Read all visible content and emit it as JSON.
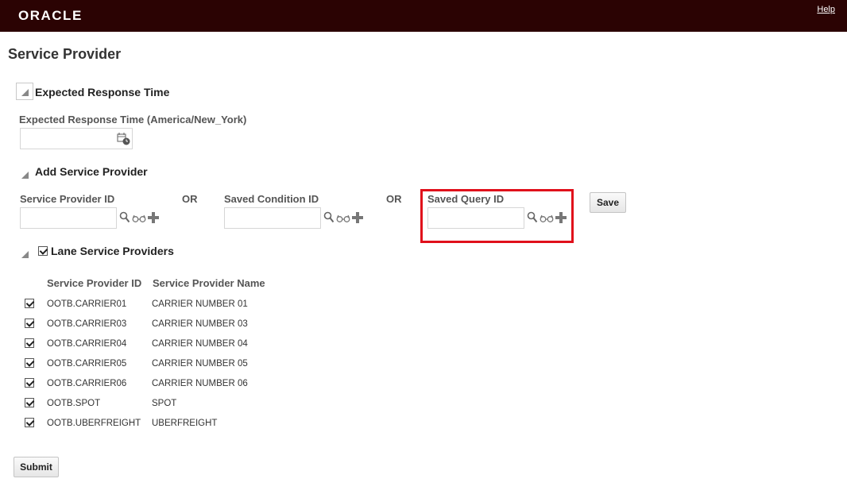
{
  "header": {
    "logo": "ORACLE",
    "help_label": "Help"
  },
  "page": {
    "title": "Service Provider"
  },
  "expected_response": {
    "section_title": "Expected Response Time",
    "field_label": "Expected Response Time (America/New_York)",
    "field_value": ""
  },
  "add_provider": {
    "section_title": "Add Service Provider",
    "provider_id_label": "Service Provider ID",
    "or_1": "OR",
    "saved_condition_label": "Saved Condition ID",
    "or_2": "OR",
    "saved_query_label": "Saved Query ID",
    "save_label": "Save"
  },
  "lane": {
    "section_title": "Lane Service Providers",
    "columns": [
      "Service Provider ID",
      "Service Provider Name"
    ],
    "rows": [
      {
        "id": "OOTB.CARRIER01",
        "name": "CARRIER NUMBER 01",
        "checked": true
      },
      {
        "id": "OOTB.CARRIER03",
        "name": "CARRIER NUMBER 03",
        "checked": true
      },
      {
        "id": "OOTB.CARRIER04",
        "name": "CARRIER NUMBER 04",
        "checked": true
      },
      {
        "id": "OOTB.CARRIER05",
        "name": "CARRIER NUMBER 05",
        "checked": true
      },
      {
        "id": "OOTB.CARRIER06",
        "name": "CARRIER NUMBER 06",
        "checked": true
      },
      {
        "id": "OOTB.SPOT",
        "name": "SPOT",
        "checked": true
      },
      {
        "id": "OOTB.UBERFREIGHT",
        "name": "UBERFREIGHT",
        "checked": true
      }
    ]
  },
  "footer": {
    "submit_label": "Submit"
  },
  "colors": {
    "topbar": "#2b0303",
    "highlight": "#e0101b"
  }
}
